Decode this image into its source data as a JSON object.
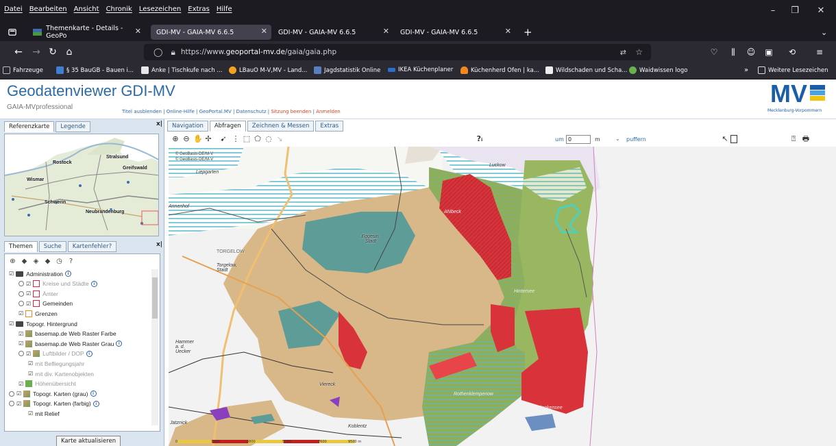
{
  "browser": {
    "menu": [
      "Datei",
      "Bearbeiten",
      "Ansicht",
      "Chronik",
      "Lesezeichen",
      "Extras",
      "Hilfe"
    ],
    "tabs": [
      {
        "label": "Themenkarte - Details - GeoPo"
      },
      {
        "label": "GDI-MV - GAIA-MV 6.6.5"
      },
      {
        "label": "GDI-MV - GAIA-MV 6.6.5"
      },
      {
        "label": "GDI-MV - GAIA-MV 6.6.5"
      }
    ],
    "url_prefix": "https://www.",
    "url_host": "geoportal-mv.de",
    "url_path": "/gaia/gaia.php",
    "bookmarks": [
      {
        "label": "Fahrzeuge",
        "color": "#bbbbbb"
      },
      {
        "label": "§ 35 BauGB - Bauen i...",
        "color": "#3f7fd0"
      },
      {
        "label": "Anke | Tischkufe nach ...",
        "color": "#e8e8e8"
      },
      {
        "label": "LBauO M-V,MV - Land...",
        "color": "#f3a21d"
      },
      {
        "label": "Jagdstatistik Online",
        "color": "#5a7fc0"
      },
      {
        "label": "IKEA Küchenplaner",
        "color": "#2a6fd0"
      },
      {
        "label": "Küchenherd Ofen | ka...",
        "color": "#f08a1c"
      },
      {
        "label": "Wildschaden und Scha...",
        "color": "#eeeeee"
      },
      {
        "label": "Waidwissen logo",
        "color": "#6ab04c"
      }
    ],
    "more_bookmarks": "Weitere Lesezeichen"
  },
  "header": {
    "title": "Geodatenviewer GDI-MV",
    "subtitle": "GAIA-MVprofessional",
    "links": {
      "hide_title": "Titel ausblenden",
      "help": "Online-Hilfe",
      "geoportal": "GeoPortal.MV",
      "privacy": "Datenschutz",
      "end_session": "Sitzung beenden",
      "login": "Anmelden"
    },
    "logo_text": "MV",
    "logo_caption": "Mecklenburg-Vorpommern",
    "logo_colors": [
      "#1a5ea9",
      "#4aa3df",
      "#f1c40f"
    ]
  },
  "left_panel": {
    "top_tabs": [
      "Referenzkarte",
      "Legende"
    ],
    "overview_labels": [
      "Stralsund",
      "Rostock",
      "Greifswald",
      "Wismar",
      "Schwerin",
      "Neubrandenburg"
    ],
    "theme_tabs": [
      "Themen",
      "Suche",
      "Kartenfehler?"
    ],
    "tree": [
      {
        "label": "Administration",
        "type": "folder",
        "info": true
      },
      {
        "label": "Kreise und Städte",
        "type": "layer-pink",
        "info": true,
        "grey": true
      },
      {
        "label": "Ämter",
        "type": "layer-pink",
        "info": false,
        "grey": true
      },
      {
        "label": "Gemeinden",
        "type": "layer-pink",
        "info": false
      },
      {
        "label": "Grenzen",
        "type": "layer-orange",
        "info": false
      },
      {
        "label": "Topogr. Hintergrund",
        "type": "folder",
        "info": false
      },
      {
        "label": "basemap.de Web Raster Farbe",
        "type": "layer-img",
        "info": false
      },
      {
        "label": "basemap.de Web Raster Grau",
        "type": "layer-img",
        "info": true
      },
      {
        "label": "Luftbilder / DOP",
        "type": "layer-img",
        "info": true,
        "grey": true
      },
      {
        "label": "mit Befliegungsjahr",
        "type": "sub",
        "info": false,
        "grey": true
      },
      {
        "label": "mit div. Kartenobjekten",
        "type": "sub",
        "info": false,
        "grey": true
      },
      {
        "label": "Höhenübersicht",
        "type": "layer-green",
        "info": false,
        "grey": true
      },
      {
        "label": "Topogr. Karten (grau)",
        "type": "layer-img",
        "info": true
      },
      {
        "label": "Topogr. Karten (farbig)",
        "type": "layer-img",
        "info": true
      },
      {
        "label": "mit Relief",
        "type": "sub",
        "info": false
      }
    ],
    "refresh_button": "Karte aktualisieren"
  },
  "map_panel": {
    "tabs": [
      "Navigation",
      "Abfragen",
      "Zeichnen & Messen",
      "Extras"
    ],
    "active_tab": "Abfragen",
    "buffer_prefix": "um",
    "buffer_value": "0",
    "buffer_unit": "m",
    "buffer_action": "puffern",
    "labels": {
      "copyright1": "© GeoBasis-DE/M-V",
      "copyright2": "© GeoBasis-DE/M-V",
      "liepgarten": "Liepgarten",
      "luckow": "Luckow",
      "annenhof": "Annenhof",
      "ahlbeck": "Ahlbeck",
      "eggesin": "Eggesin, Stadt",
      "torgelow": "Torgelow, Stadt",
      "torgelow_upper": "TORGELOW",
      "hintersee": "Hintersee",
      "hammer": "Hammer a. d. Uecker",
      "vierreck": "Viereck",
      "rothenklempenow": "Rothenklempenow",
      "blankensee": "Blankensee",
      "jatznick": "Jatznick",
      "koblentz": "Koblentz"
    },
    "scale_numbers": [
      "0",
      "1900",
      "3800",
      "5700",
      "7600",
      "9500 m"
    ]
  }
}
